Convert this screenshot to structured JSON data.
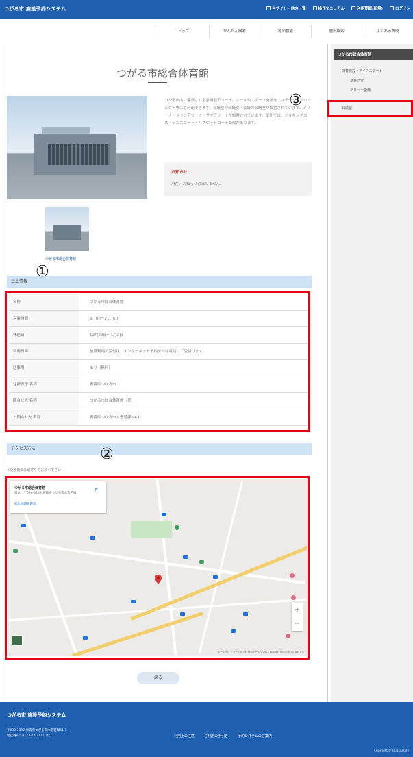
{
  "header": {
    "brand": "つがる市 施設予約システム",
    "links": [
      {
        "label": "当サイト・他の一覧",
        "icon": "info-icon"
      },
      {
        "label": "操作マニュアル",
        "icon": "book-icon"
      },
      {
        "label": "利用登録(新規)",
        "icon": "pin-icon"
      },
      {
        "label": "ログイン",
        "icon": "login-icon"
      }
    ]
  },
  "nav": {
    "items": [
      "トップ",
      "かんたん検索",
      "地図検索",
      "施設検索",
      "よくある質問"
    ]
  },
  "main": {
    "title": "つがる市総合体育館",
    "description": "つがる市内に建設される多機能アリーナ。ホールやスポーツ施設を、ステージ・プロジェクト等にも利用できます。会議室や会議室・会議の会議室が設置されています。アリーナ・メインアリーナ・サブアリーナが設置されています。屋外では、ジョギングコース・テニスコート・バスケットコート設備があります。",
    "notice_title": "お知らせ",
    "notice_text": "現在、お知らせはありません。",
    "thumb_caption": "つがる市総合体育館",
    "basic_info_title": "基本情報",
    "info_rows": [
      {
        "label": "名称",
        "value": "つがる市総合体育館"
      },
      {
        "label": "営業時間",
        "value": "9：00～21：00"
      },
      {
        "label": "休館日",
        "value": "12月29日～1月3日"
      },
      {
        "label": "利用日時",
        "value": "施設利用の受付は、インターネット予約または電話にて受付けます。"
      },
      {
        "label": "駐車場",
        "value": "あり（無料）"
      },
      {
        "label": "住所表示 名称",
        "value": "青森県つがる市"
      },
      {
        "label": "問合せ先 名称",
        "value": "つがる市総合体育館（代）"
      },
      {
        "label": "お問合せ先 名称",
        "value": "青森県つがる市木造若緑59-1"
      }
    ],
    "access_title": "アクセス方法",
    "access_note": "※交通機関は最寄りでお調べ下さい",
    "map": {
      "card_title": "つがる市総合体育館",
      "card_address": "日本、〒038-3138 青森県つがる市木造若緑",
      "card_link": "拡大地図を表示",
      "attribution": "キーボード ショートカット  地図データ ©2024  利用規約  地図の誤りを報告する",
      "zoom_in": "+",
      "zoom_out": "−"
    },
    "back_label": "戻る"
  },
  "sidebar": {
    "title": "つがる市総合体育館",
    "items": [
      {
        "label": "体育施設・アイススケート",
        "level": 0
      },
      {
        "label": "多目的室",
        "level": 1
      },
      {
        "label": "アリーナ設備",
        "level": 1
      },
      {
        "label": "会議室",
        "level": 0
      }
    ]
  },
  "annotations": [
    "①",
    "②",
    "③"
  ],
  "footer": {
    "brand": "つがる市 施設予約システム",
    "address": "〒038-3192 青森県つがる市木造若緑61-1",
    "contact": "電話番号：0173-42-2111（代）",
    "links": [
      "利用上の注意",
      "ご利用の手引き",
      "予約システムのご案内"
    ],
    "copyright": "Copyright © Tsugaru City"
  },
  "colors": {
    "brand_blue": "#1f5fb0",
    "annotation_red": "#e60012",
    "section_blue": "#cfe3f6"
  }
}
